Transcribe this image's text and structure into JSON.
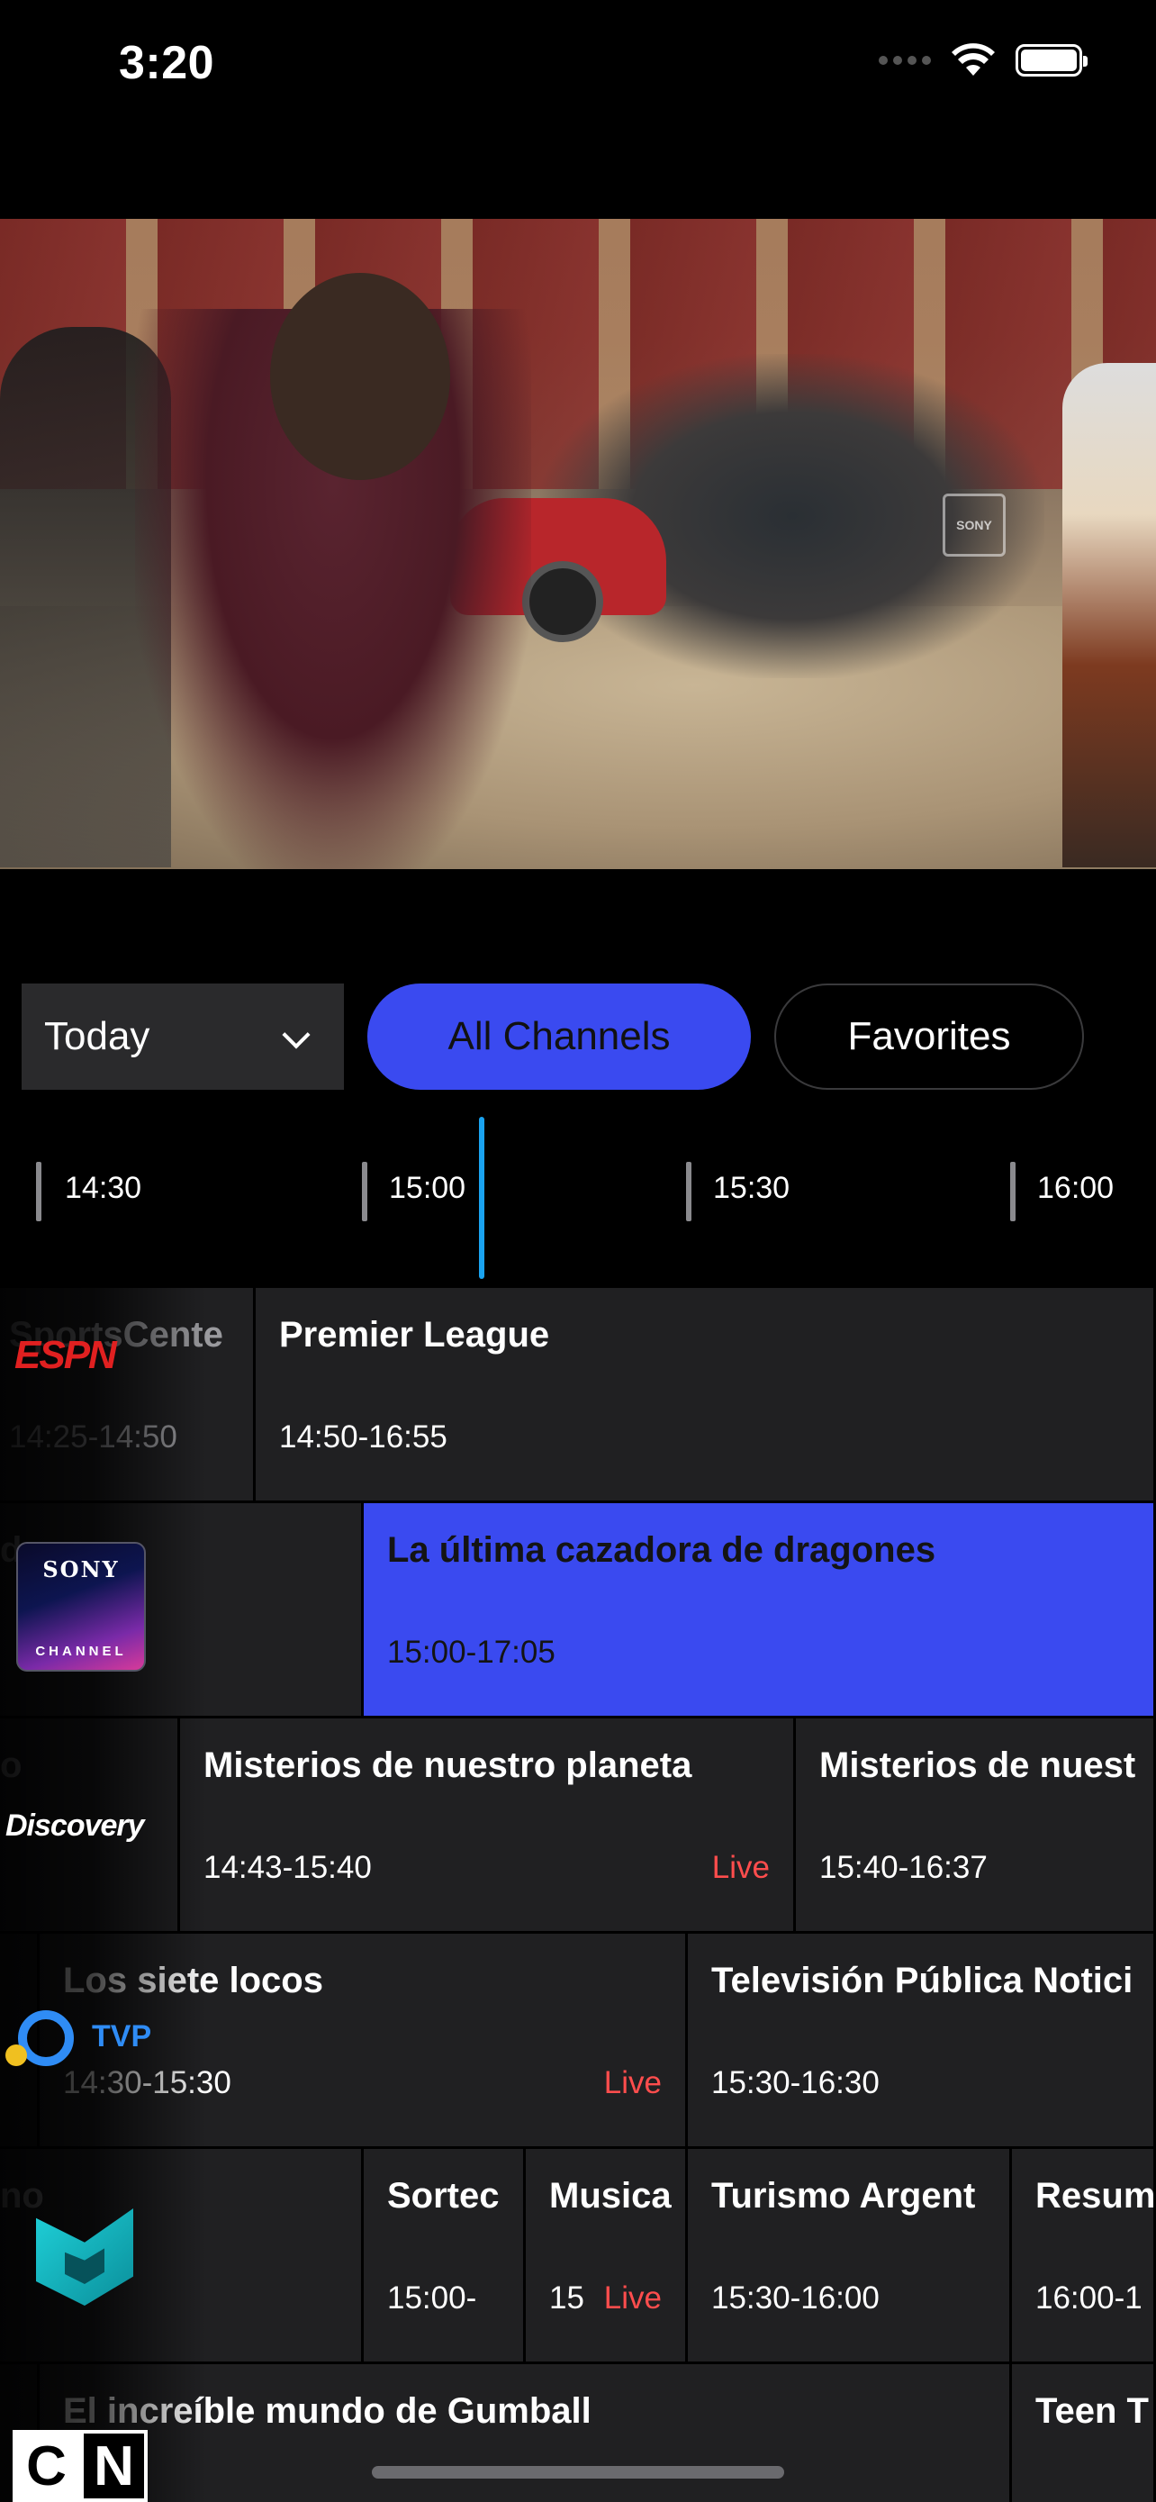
{
  "status_bar": {
    "time": "3:20",
    "icons": [
      "cellular-signal-icon",
      "wifi-icon",
      "battery-icon"
    ]
  },
  "video": {
    "description_icon": "video-frame",
    "watermark": "SONY"
  },
  "controls": {
    "date_value": "Today",
    "date_icon": "chevron-down-icon",
    "tabs": [
      {
        "label": "All Channels",
        "active": true
      },
      {
        "label": "Favorites",
        "active": false
      }
    ],
    "active_color": "#3a4af0"
  },
  "timeline": {
    "ticks": [
      "14:30",
      "15:00",
      "15:30",
      "16:00"
    ],
    "now_color": "#1aa3f0"
  },
  "guide": {
    "rows": [
      {
        "channel_logo": "ESPN",
        "programs": [
          {
            "title": "SportsCente",
            "time": "14:25-14:50",
            "live": "",
            "faded": true
          },
          {
            "title": "Premier League",
            "time": "14:50-16:55",
            "live": ""
          }
        ]
      },
      {
        "channel_logo": {
          "top": "SONY",
          "bottom": "CHANNEL"
        },
        "programs": [
          {
            "title": "d",
            "time": "",
            "live": "",
            "faded": true
          },
          {
            "title": "La última cazadora de dragones",
            "time": "15:00-17:05",
            "live": "",
            "selected": true
          }
        ]
      },
      {
        "channel_logo": "Discovery",
        "programs": [
          {
            "title": "o",
            "time": "",
            "live": "",
            "faded": true
          },
          {
            "title": "Misterios de nuestro planeta",
            "time": "14:43-15:40",
            "live": "Live"
          },
          {
            "title": "Misterios de nuest",
            "time": "15:40-16:37",
            "live": ""
          }
        ]
      },
      {
        "channel_logo": "TVP",
        "programs": [
          {
            "title": "Los siete locos",
            "time": "14:30-15:30",
            "live": "Live"
          },
          {
            "title": "Televisión Pública Notici",
            "time": "15:30-16:30",
            "live": ""
          }
        ]
      },
      {
        "channel_logo": "mix-icon",
        "programs": [
          {
            "title": "no",
            "time": "",
            "live": "",
            "faded": true
          },
          {
            "title": "Sortec",
            "time": "15:00-",
            "live": ""
          },
          {
            "title": "Musica",
            "time": "15",
            "live": "Live"
          },
          {
            "title": "Turismo Argent",
            "time": "15:30-16:00",
            "live": ""
          },
          {
            "title": "Resum",
            "time": "16:00-1",
            "live": ""
          }
        ]
      },
      {
        "channel_logo": "CN",
        "programs": [
          {
            "title": "El increíble mundo de Gumball",
            "time": "",
            "live": ""
          },
          {
            "title": "Teen T",
            "time": "",
            "live": ""
          }
        ]
      }
    ],
    "live_color": "#ff4d4d"
  }
}
